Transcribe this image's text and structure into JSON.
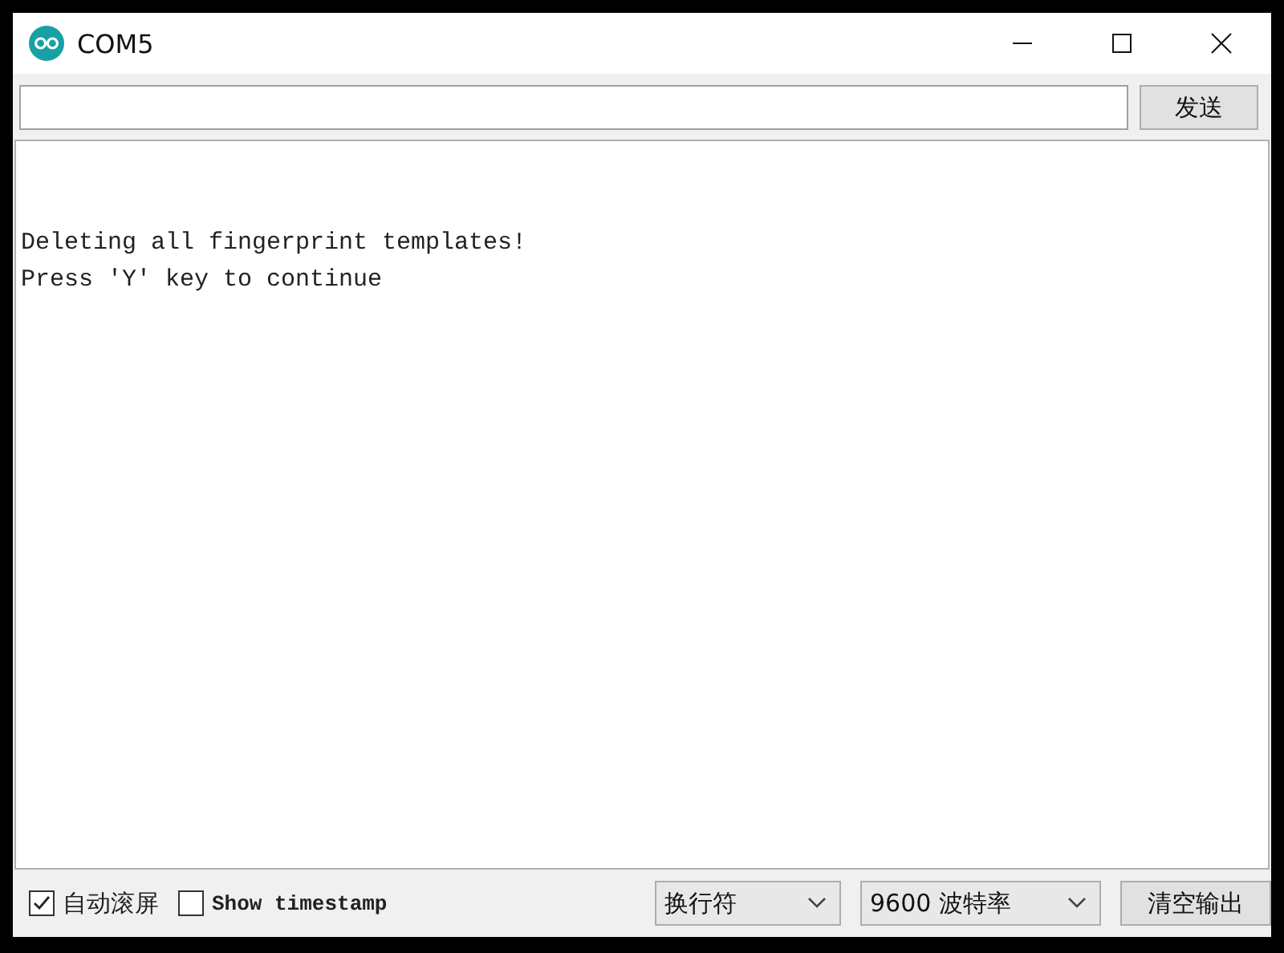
{
  "window": {
    "title": "COM5"
  },
  "send_button": "发送",
  "output_lines": [
    "Deleting all fingerprint templates!",
    "Press 'Y' key to continue"
  ],
  "autoscroll": {
    "label": "自动滚屏",
    "checked": true
  },
  "timestamp": {
    "label": "Show timestamp",
    "checked": false
  },
  "line_ending": {
    "value": "换行符"
  },
  "baud_rate": {
    "value": "9600 波特率"
  },
  "clear_button": "清空输出"
}
